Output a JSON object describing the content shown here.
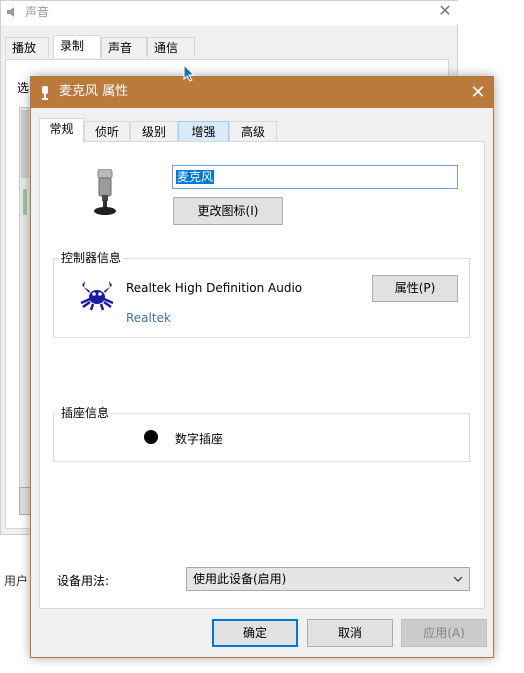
{
  "background_window": {
    "title": "声音",
    "tabs": [
      "播放",
      "录制",
      "声音",
      "通信"
    ],
    "active_tab": 1,
    "label_partial": "选",
    "footer_partial": "用户"
  },
  "dialog": {
    "title": "麦克风 属性",
    "tabs": [
      "常规",
      "侦听",
      "级别",
      "增强",
      "高级"
    ],
    "active_tab": 0,
    "hover_tab": 3,
    "device_name": "麦克风",
    "change_icon_button": "更改图标(I)",
    "controller_group": {
      "label": "控制器信息",
      "name": "Realtek High Definition Audio",
      "vendor": "Realtek",
      "properties_button": "属性(P)"
    },
    "jack_group": {
      "label": "插座信息",
      "jack": "数字插座"
    },
    "device_usage": {
      "label": "设备用法:",
      "selected": "使用此设备(启用)"
    },
    "buttons": {
      "ok": "确定",
      "cancel": "取消",
      "apply": "应用(A)"
    }
  },
  "colors": {
    "titlebar": "#b97a3c",
    "accent": "#0078d7",
    "link": "#3a6fb7"
  }
}
